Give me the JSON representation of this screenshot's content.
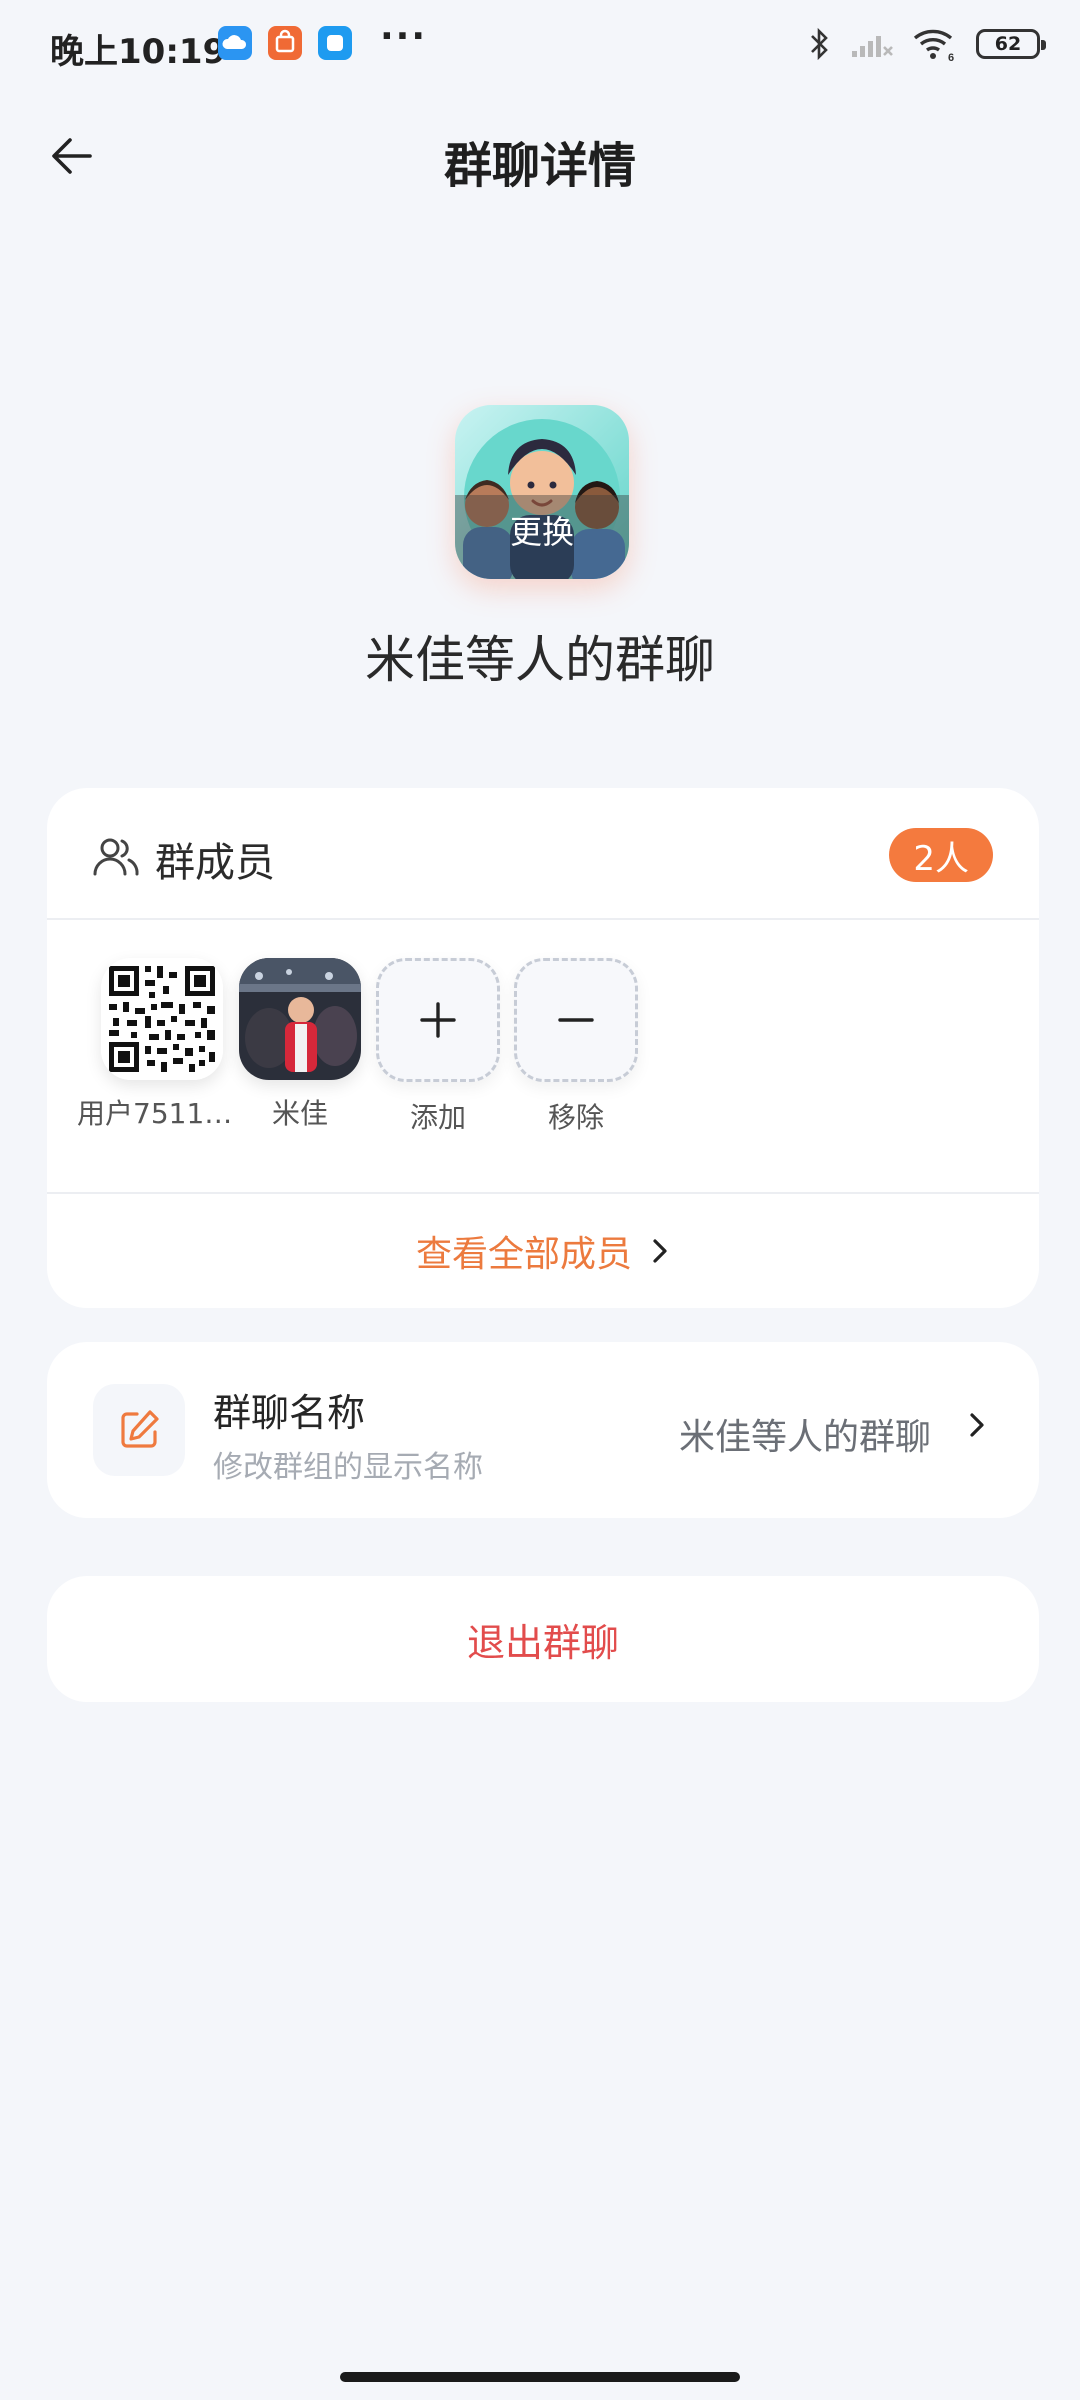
{
  "status_bar": {
    "time": "晚上10:19",
    "battery": "62"
  },
  "header": {
    "title": "群聊详情"
  },
  "group": {
    "avatar_change_label": "更换",
    "name": "米佳等人的群聊"
  },
  "members_section": {
    "title": "群成员",
    "count_badge": "2人",
    "members": [
      {
        "name": "用户751135..."
      },
      {
        "name": "米佳"
      }
    ],
    "add_label": "添加",
    "remove_label": "移除",
    "view_all_label": "查看全部成员"
  },
  "group_name_setting": {
    "title": "群聊名称",
    "subtitle": "修改群组的显示名称",
    "value": "米佳等人的群聊"
  },
  "exit_button": {
    "label": "退出群聊"
  },
  "colors": {
    "accent": "#f47a3e",
    "danger": "#e24c4c",
    "background": "#f4f6fa"
  }
}
